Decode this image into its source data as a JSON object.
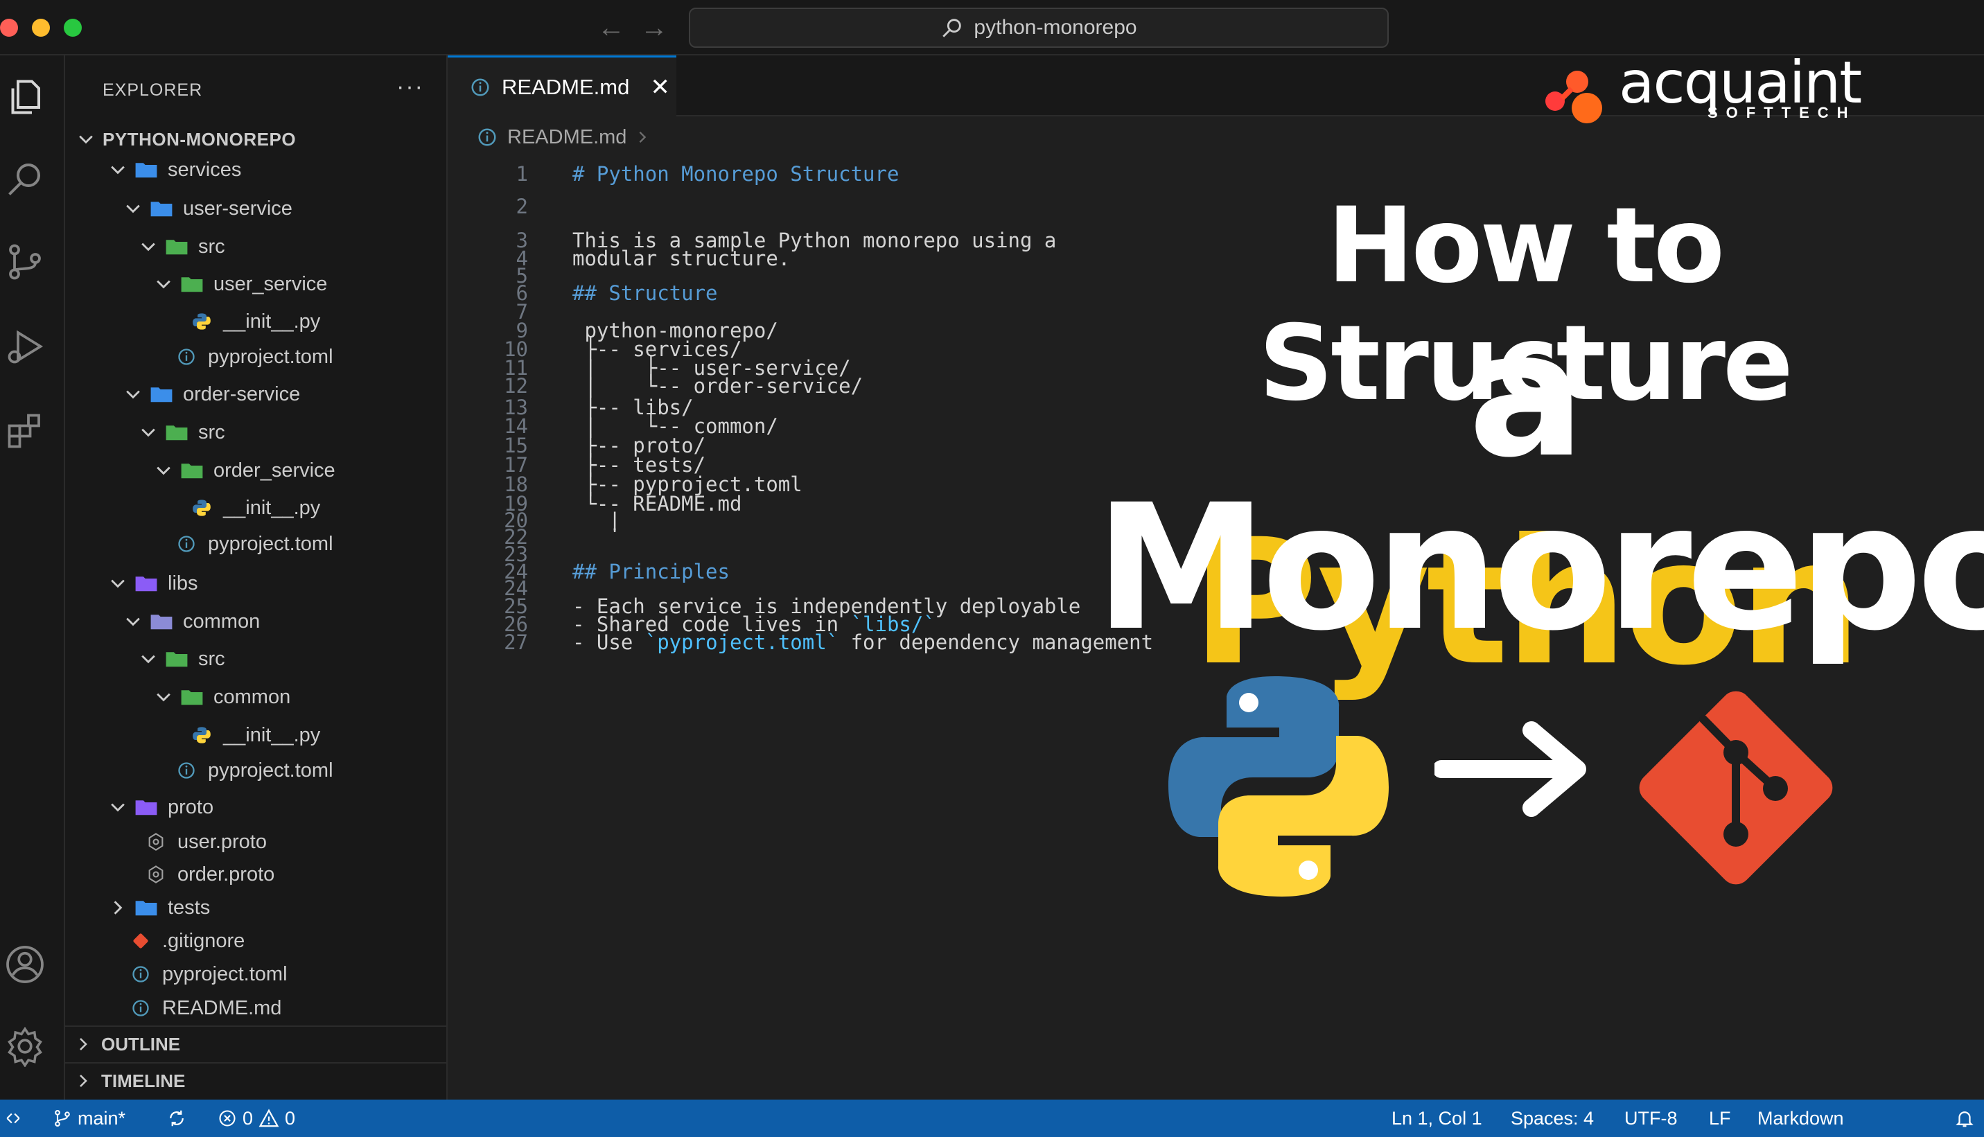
{
  "titlebar": {
    "search_text": "python-monorepo"
  },
  "sidebar": {
    "header": "EXPLORER",
    "more": "···",
    "root": "PYTHON-MONOREPO",
    "tree": [
      {
        "label": "services",
        "type": "folder",
        "color": "#3b8eea",
        "depth": 1,
        "open": true
      },
      {
        "label": "user-service",
        "type": "folder",
        "color": "#3b8eea",
        "depth": 2,
        "open": true
      },
      {
        "label": "src",
        "type": "folder",
        "color": "#4caf50",
        "depth": 3,
        "open": true
      },
      {
        "label": "user_service",
        "type": "folder",
        "color": "#4caf50",
        "depth": 4,
        "open": true
      },
      {
        "label": "__init__.py",
        "type": "python",
        "depth": 5
      },
      {
        "label": "pyproject.toml",
        "type": "info",
        "depth": 4
      },
      {
        "label": "order-service",
        "type": "folder",
        "color": "#3b8eea",
        "depth": 2,
        "open": true
      },
      {
        "label": "src",
        "type": "folder",
        "color": "#4caf50",
        "depth": 3,
        "open": true
      },
      {
        "label": "order_service",
        "type": "folder",
        "color": "#4caf50",
        "depth": 4,
        "open": true
      },
      {
        "label": "__init__.py",
        "type": "python",
        "depth": 5
      },
      {
        "label": "pyproject.toml",
        "type": "info",
        "depth": 4
      },
      {
        "label": "libs",
        "type": "folder",
        "color": "#8b5cf6",
        "depth": 1,
        "open": true
      },
      {
        "label": "common",
        "type": "folder",
        "color": "#8b8bd6",
        "depth": 2,
        "open": true
      },
      {
        "label": "src",
        "type": "folder",
        "color": "#4caf50",
        "depth": 3,
        "open": true
      },
      {
        "label": "common",
        "type": "folder",
        "color": "#4caf50",
        "depth": 4,
        "open": true
      },
      {
        "label": "__init__.py",
        "type": "python",
        "depth": 5
      },
      {
        "label": "pyproject.toml",
        "type": "info",
        "depth": 4
      },
      {
        "label": "proto",
        "type": "folder",
        "color": "#8b5cf6",
        "depth": 1,
        "open": true
      },
      {
        "label": "user.proto",
        "type": "proto",
        "depth": 2
      },
      {
        "label": "order.proto",
        "type": "proto",
        "depth": 2
      },
      {
        "label": "tests",
        "type": "folder",
        "color": "#3b8eea",
        "depth": 1,
        "open": false
      },
      {
        "label": ".gitignore",
        "type": "git",
        "depth": 1
      },
      {
        "label": "pyproject.toml",
        "type": "info",
        "depth": 1
      },
      {
        "label": "README.md",
        "type": "info",
        "depth": 1
      }
    ],
    "sections": [
      "OUTLINE",
      "TIMELINE"
    ]
  },
  "editor": {
    "tab_label": "README.md",
    "tab_close": "✕",
    "breadcrumb": "README.md",
    "lines": [
      {
        "n": "1",
        "text": "# Python Monorepo Structure",
        "kind": "heading"
      },
      {
        "n": "2",
        "text": "",
        "kind": "plain"
      },
      {
        "n": "3",
        "text": "This is a sample Python monorepo using a",
        "kind": "plain"
      },
      {
        "n": "4",
        "text": "modular structure.",
        "kind": "plain"
      },
      {
        "n": "5",
        "text": "",
        "kind": "plain"
      },
      {
        "n": "6",
        "text": "## Structure",
        "kind": "heading"
      },
      {
        "n": "7",
        "text": "",
        "kind": "plain"
      },
      {
        "n": "9",
        "text": " python-monorepo/",
        "kind": "plain"
      },
      {
        "n": "10",
        "text": " ├-- services/",
        "kind": "plain"
      },
      {
        "n": "11",
        "text": " |    ├-- user-service/",
        "kind": "plain"
      },
      {
        "n": "12",
        "text": " |    └-- order-service/",
        "kind": "plain"
      },
      {
        "n": "13",
        "text": " ├-- libs/",
        "kind": "plain"
      },
      {
        "n": "14",
        "text": " |    └-- common/",
        "kind": "plain"
      },
      {
        "n": "15",
        "text": " ├-- proto/",
        "kind": "plain"
      },
      {
        "n": "17",
        "text": " ├-- tests/",
        "kind": "plain"
      },
      {
        "n": "18",
        "text": " ├-- pyproject.toml",
        "kind": "plain"
      },
      {
        "n": "19",
        "text": " └-- README.md",
        "kind": "plain"
      },
      {
        "n": "20",
        "text": "   |",
        "kind": "plain"
      },
      {
        "n": "22",
        "text": "   ˙",
        "kind": "plain"
      },
      {
        "n": "23",
        "text": "",
        "kind": "plain"
      },
      {
        "n": "24",
        "text": "## Principles",
        "kind": "heading"
      },
      {
        "n": "24",
        "text": "",
        "kind": "plain"
      },
      {
        "n": "25",
        "text": "- Each service is independently deployable",
        "kind": "plain"
      },
      {
        "n": "26",
        "text": "- Shared code lives in `libs/`",
        "kind": "plain"
      },
      {
        "n": "27",
        "text": "- Use `pyproject.toml` for dependency management",
        "kind": "plain"
      }
    ]
  },
  "overlay": {
    "brand_name": "acquaint",
    "brand_sub": "SOFTTECH",
    "line1": "How to Structure",
    "line2_a": "a ",
    "line2_b": "Python",
    "line3": "Monorepo",
    "accent_color": "#f5c518",
    "icons": [
      "python-logo-icon",
      "arrow-right-icon",
      "git-logo-icon"
    ]
  },
  "statusbar": {
    "branch": "main*",
    "errors": "0",
    "warnings": "0",
    "cursor": "Ln 1, Col 1",
    "spaces": "Spaces: 4",
    "encoding": "UTF-8",
    "eol": "LF",
    "language": "Markdown"
  }
}
